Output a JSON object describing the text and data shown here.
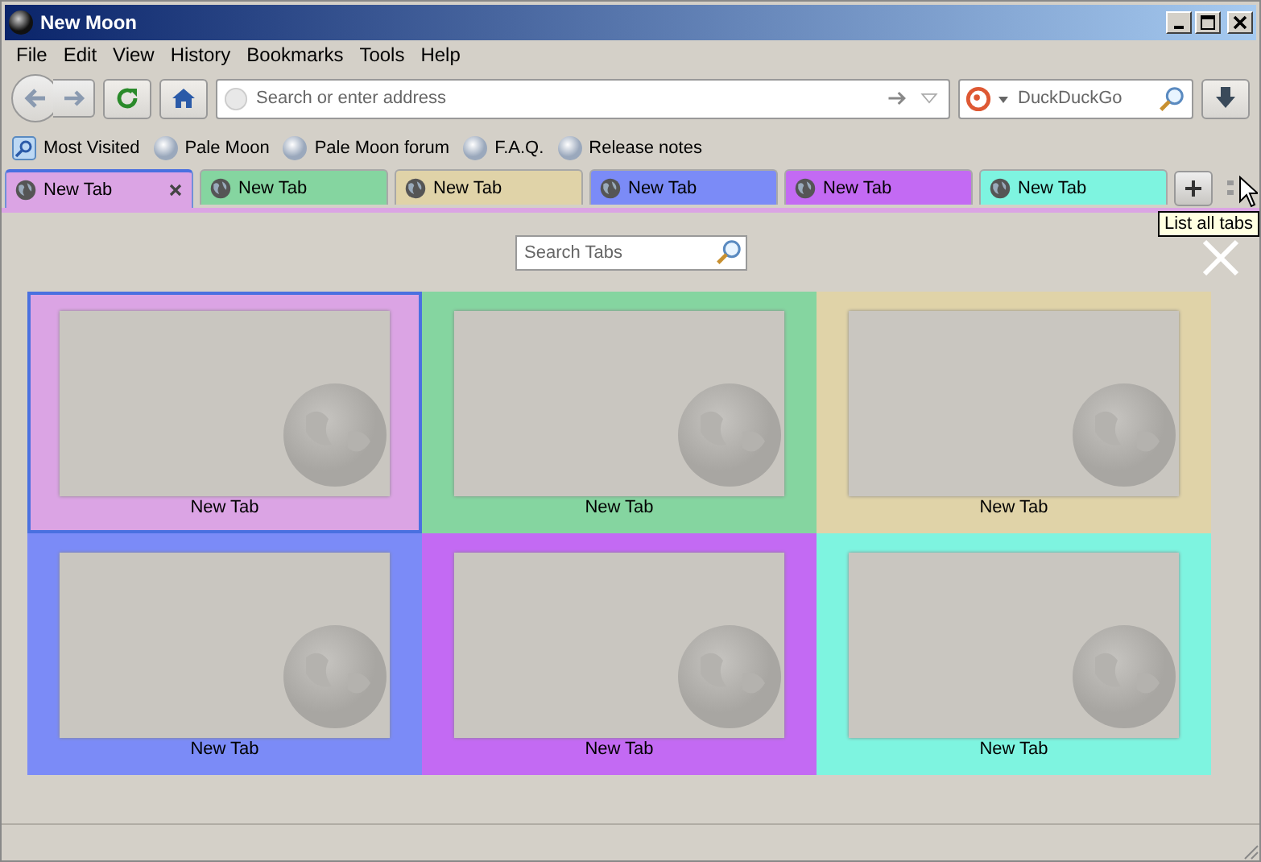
{
  "window": {
    "title": "New Moon"
  },
  "menu": [
    "File",
    "Edit",
    "View",
    "History",
    "Bookmarks",
    "Tools",
    "Help"
  ],
  "address": {
    "placeholder": "Search or enter address"
  },
  "search": {
    "placeholder": "DuckDuckGo"
  },
  "bookmarks": [
    {
      "label": "Most Visited",
      "kind": "folder"
    },
    {
      "label": "Pale Moon",
      "kind": "page"
    },
    {
      "label": "Pale Moon forum",
      "kind": "page"
    },
    {
      "label": "F.A.Q.",
      "kind": "page"
    },
    {
      "label": "Release notes",
      "kind": "page"
    }
  ],
  "tabs": [
    {
      "label": "New Tab",
      "color": "#dba4e4",
      "selected": true
    },
    {
      "label": "New Tab",
      "color": "#85d5a0",
      "selected": false
    },
    {
      "label": "New Tab",
      "color": "#e0d3a8",
      "selected": false
    },
    {
      "label": "New Tab",
      "color": "#7b8bf7",
      "selected": false
    },
    {
      "label": "New Tab",
      "color": "#c36af3",
      "selected": false
    },
    {
      "label": "New Tab",
      "color": "#7ef4e0",
      "selected": false
    }
  ],
  "tooltip": "List all tabs",
  "tab_search": {
    "placeholder": "Search Tabs"
  },
  "thumbnails": [
    {
      "label": "New Tab",
      "color": "#dba4e4",
      "selected": true
    },
    {
      "label": "New Tab",
      "color": "#85d5a0",
      "selected": false
    },
    {
      "label": "New Tab",
      "color": "#e0d3a8",
      "selected": false
    },
    {
      "label": "New Tab",
      "color": "#7b8bf7",
      "selected": false
    },
    {
      "label": "New Tab",
      "color": "#c36af3",
      "selected": false
    },
    {
      "label": "New Tab",
      "color": "#7ef4e0",
      "selected": false
    }
  ]
}
